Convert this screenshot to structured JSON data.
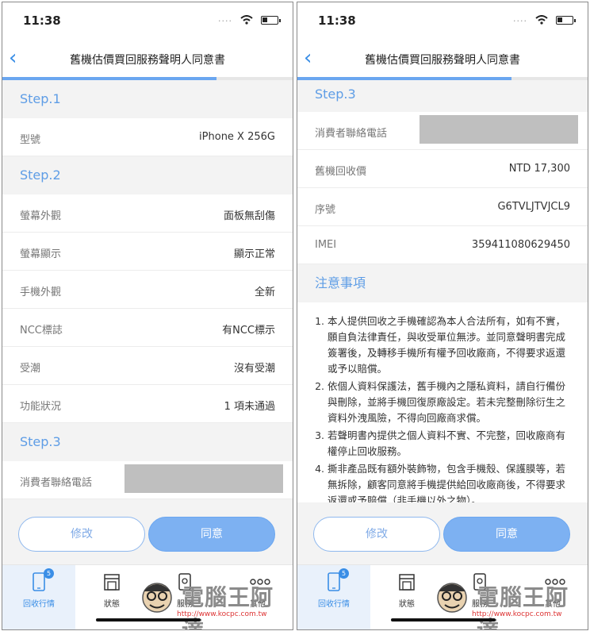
{
  "status": {
    "time": "11:38",
    "signal": "...."
  },
  "nav": {
    "back": "‹",
    "title": "舊機估價買回服務聲明人同意書"
  },
  "left": {
    "step1": "Step.1",
    "model_label": "型號",
    "model_value": "iPhone X 256G",
    "step2": "Step.2",
    "rows": [
      {
        "label": "螢幕外觀",
        "value": "面板無刮傷"
      },
      {
        "label": "螢幕顯示",
        "value": "顯示正常"
      },
      {
        "label": "手機外觀",
        "value": "全新"
      },
      {
        "label": "NCC標誌",
        "value": "有NCC標示"
      },
      {
        "label": "受潮",
        "value": "沒有受潮"
      },
      {
        "label": "功能狀況",
        "value": "1 項未通過"
      }
    ],
    "step3": "Step.3",
    "phone_label": "消費者聯絡電話"
  },
  "right": {
    "step3": "Step.3",
    "phone_label": "消費者聯絡電話",
    "rows": [
      {
        "label": "舊機回收價",
        "value": "NTD 17,300"
      },
      {
        "label": "序號",
        "value": "G6TVLJTVJCL9"
      },
      {
        "label": "IMEI",
        "value": "359411080629450"
      }
    ],
    "notes_title": "注意事項",
    "notes": [
      "本人提供回收之手機確認為本人合法所有，如有不實，願自負法律責任，與收受單位無涉。並同意聲明書完成簽署後，及轉移手機所有權予回收廠商，不得要求返還或予以賠償。",
      "依個人資料保護法，舊手機內之隱私資料，請自行備份與刪除，並將手機回復原廠設定。若未完整刪除衍生之資料外洩風險，不得向回廠商求償。",
      "若聲明書內提供之個人資料不實、不完整，回收廠商有權停止回收服務。",
      "撕非產品既有額外裝飾物，包含手機殼、保護膜等，若無拆除，顧客同意將手機提供給回收廠商後，不得要求返還或予賠償（非手機以外之物）。"
    ]
  },
  "buttons": {
    "modify": "修改",
    "agree": "同意"
  },
  "tabs": [
    {
      "label": "回收行情",
      "badge": "5"
    },
    {
      "label": "狀態"
    },
    {
      "label": "服務"
    },
    {
      "label": "其他"
    }
  ],
  "watermark": {
    "text": "電腦王阿達",
    "url": "http://www.kocpc.com.tw"
  },
  "colors": {
    "accent": "#3a8ee6",
    "section": "#5e9de6",
    "agree": "#7db1f2"
  }
}
